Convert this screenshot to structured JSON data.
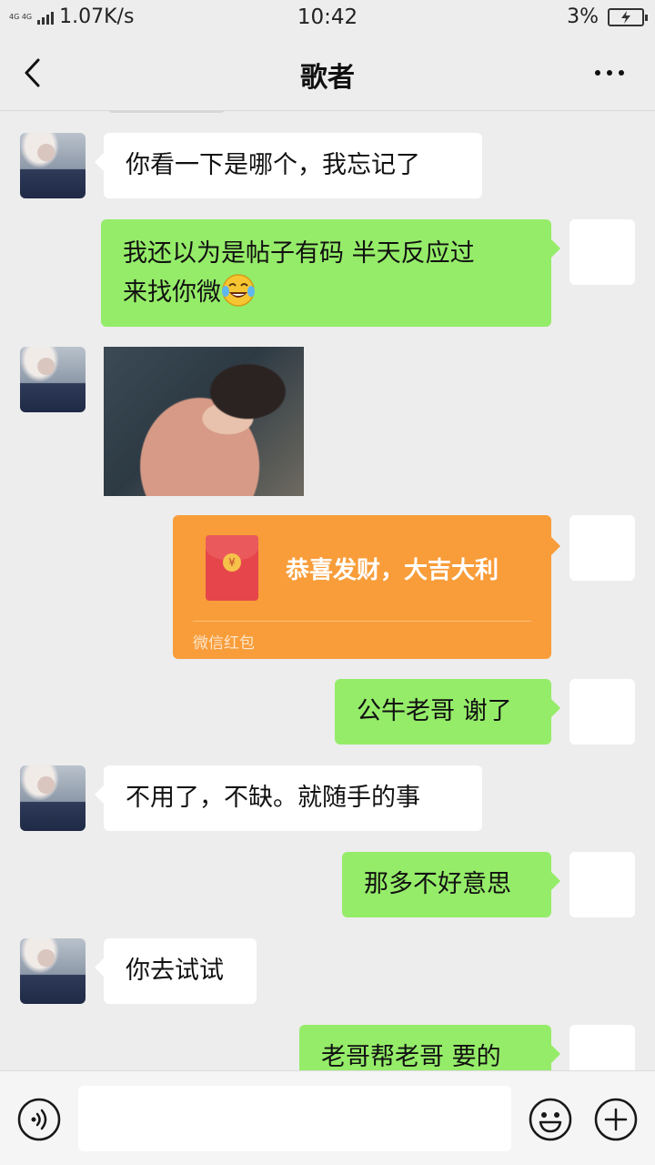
{
  "status_bar": {
    "network": "4G 4G",
    "speed": "1.07K/s",
    "time": "10:42",
    "battery": "3%"
  },
  "nav": {
    "title": "歌者",
    "back_icon": "chevron-left-icon",
    "more_icon": "more-dots-icon"
  },
  "messages": [
    {
      "side": "left",
      "type": "text",
      "text": "你看一下是哪个，我忘记了"
    },
    {
      "side": "right",
      "type": "text",
      "line1": "我还以为是帖子有码 半天反应过",
      "line2": "来找你微",
      "emoji": "tears-of-joy-emoji"
    },
    {
      "side": "left",
      "type": "image",
      "label": "photo"
    },
    {
      "side": "right",
      "type": "red-packet",
      "text": "恭喜发财，大吉大利",
      "footer": "微信红包",
      "symbol": "¥"
    },
    {
      "side": "right",
      "type": "text",
      "text": "公牛老哥 谢了"
    },
    {
      "side": "left",
      "type": "text",
      "text": "不用了，不缺。就随手的事"
    },
    {
      "side": "right",
      "type": "text",
      "text": "那多不好意思"
    },
    {
      "side": "left",
      "type": "text",
      "text": "你去试试"
    },
    {
      "side": "right",
      "type": "text",
      "text": "老哥帮老哥 要的"
    }
  ],
  "input_bar": {
    "voice_icon": "voice-icon",
    "input_value": "",
    "emoji_icon": "emoji-icon",
    "plus_icon": "plus-icon"
  },
  "colors": {
    "background": "#ededed",
    "bubble_right": "#95ec69",
    "bubble_left": "#ffffff",
    "red_packet": "#f89d3a"
  }
}
